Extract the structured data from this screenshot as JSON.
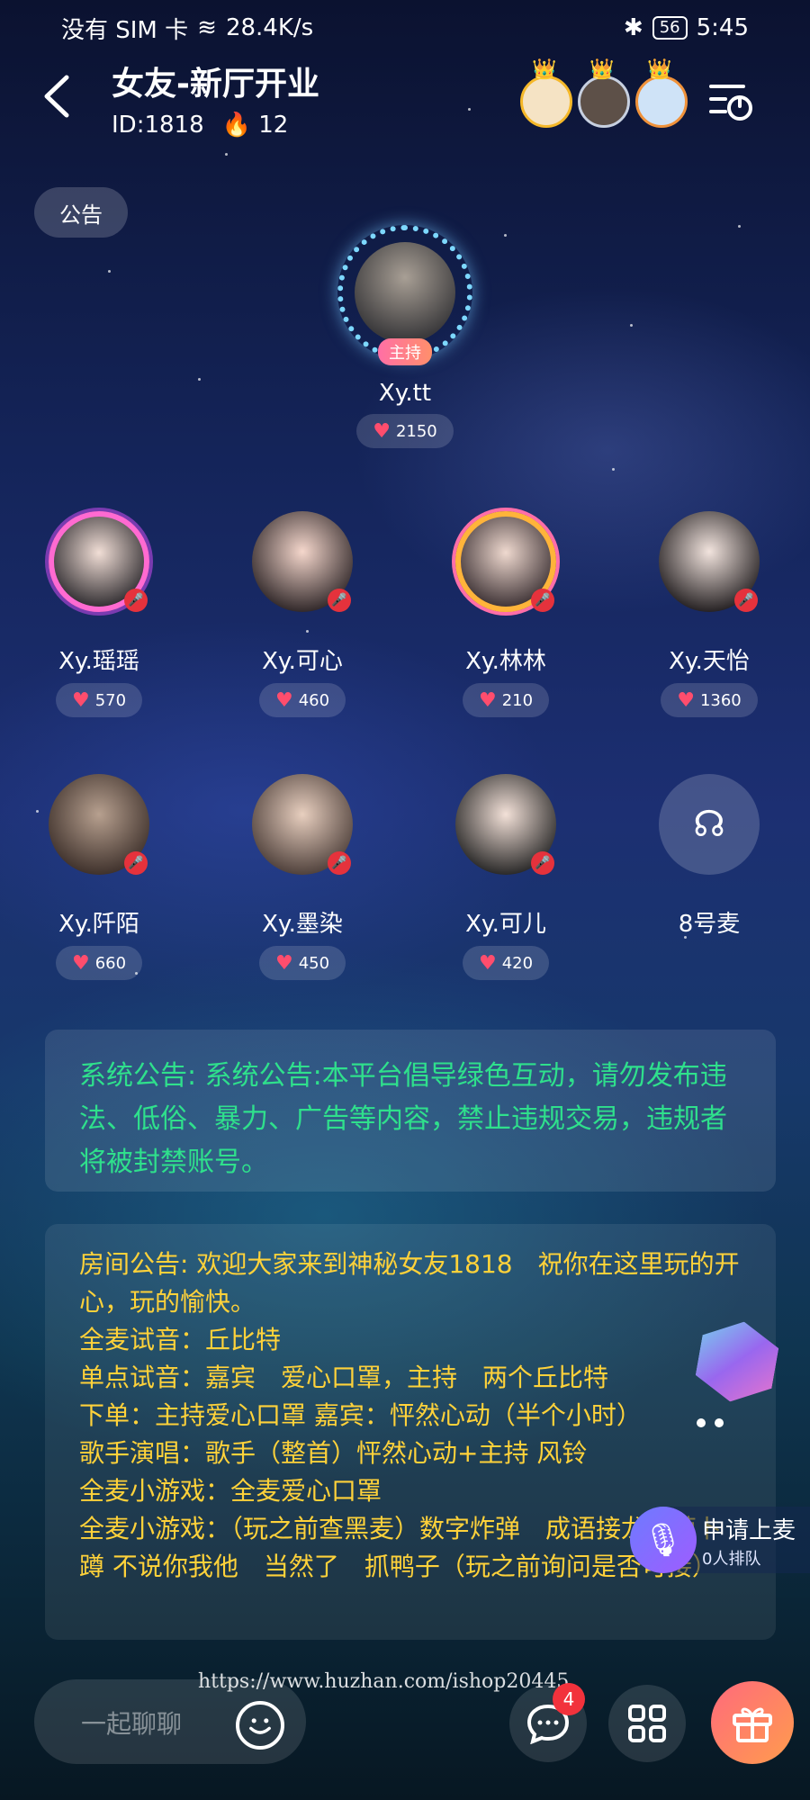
{
  "status_bar": {
    "carrier": "没有 SIM 卡",
    "speed": "28.4K/s",
    "battery": "56",
    "time": "5:45"
  },
  "room": {
    "title": "女友-新厅开业",
    "id_label": "ID:1818",
    "heat": "12"
  },
  "notice_pill": "公告",
  "host": {
    "name": "Xy.tt",
    "badge": "主持",
    "hearts": "2150"
  },
  "seats": [
    {
      "name": "Xy.瑶瑶",
      "hearts": "570",
      "muted": true
    },
    {
      "name": "Xy.可心",
      "hearts": "460",
      "muted": true
    },
    {
      "name": "Xy.林林",
      "hearts": "210",
      "muted": true
    },
    {
      "name": "Xy.天怡",
      "hearts": "1360",
      "muted": true
    },
    {
      "name": "Xy.阡陌",
      "hearts": "660",
      "muted": true
    },
    {
      "name": "Xy.墨染",
      "hearts": "450",
      "muted": true
    },
    {
      "name": "Xy.可儿",
      "hearts": "420",
      "muted": true
    },
    {
      "name": "8号麦",
      "empty": true
    }
  ],
  "system_notice": "系统公告: 系统公告:本平台倡导绿色互动，请勿发布违法、低俗、暴力、广告等内容，禁止违规交易，违规者将被封禁账号。",
  "room_notice": {
    "lines": [
      "房间公告: 欢迎大家来到神秘女友1818　祝你在这里玩的开心，玩的愉快。",
      "全麦试音：丘比特",
      "单点试音：嘉宾　爱心口罩，主持　两个丘比特",
      "下单：主持爱心口罩 嘉宾：怦然心动（半个小时）",
      "歌手演唱：歌手（整首）怦然心动+主持 风铃",
      "全麦小游戏：全麦爱心口罩",
      "全麦小游戏：（玩之前查黑麦）数字炸弹　成语接龙　萝卜蹲 不说你我他　当然了　抓鸭子（玩之前询问是否可接）"
    ]
  },
  "apply_mic": {
    "label": "申请上麦",
    "queue": "0人排队"
  },
  "watermark": "https://www.huzhan.com/ishop20445",
  "bottom_bar": {
    "chat_placeholder": "一起聊聊",
    "message_count": "4"
  },
  "icons": [
    "back-icon",
    "menu-icon",
    "heart-icon",
    "fire-icon",
    "mute-icon",
    "mic-icon",
    "emoji-icon",
    "chat-icon",
    "grid-icon",
    "gift-icon"
  ]
}
